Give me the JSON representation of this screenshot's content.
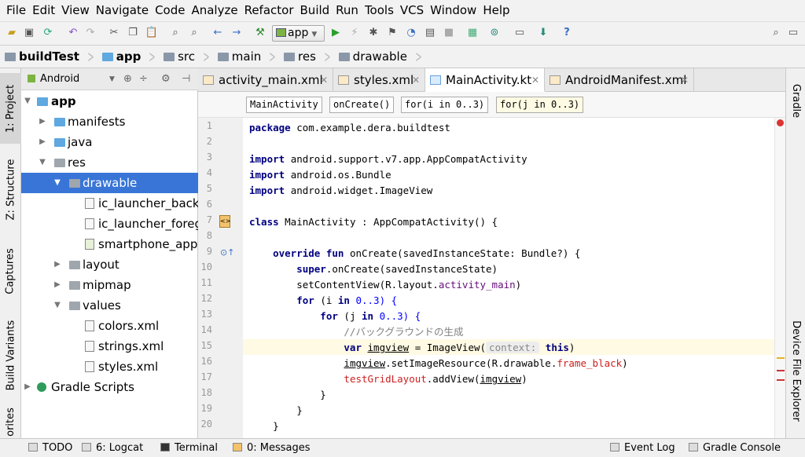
{
  "menu": [
    "File",
    "Edit",
    "View",
    "Navigate",
    "Code",
    "Analyze",
    "Refactor",
    "Build",
    "Run",
    "Tools",
    "VCS",
    "Window",
    "Help"
  ],
  "toolbar": {
    "run_config": "app"
  },
  "breadcrumb": [
    "buildTest",
    "app",
    "src",
    "main",
    "res",
    "drawable"
  ],
  "left_tabs": {
    "project": "1: Project",
    "structure": "Z: Structure",
    "captures": "Captures",
    "build_variants": "Build Variants",
    "favorites": "orites"
  },
  "project_panel": {
    "view_mode": "Android"
  },
  "tree": [
    {
      "label": "app"
    },
    {
      "label": "manifests"
    },
    {
      "label": "java"
    },
    {
      "label": "res"
    },
    {
      "label": "drawable"
    },
    {
      "label": "ic_launcher_backg"
    },
    {
      "label": "ic_launcher_foreg"
    },
    {
      "label": "smartphone_app.p"
    },
    {
      "label": "layout"
    },
    {
      "label": "mipmap"
    },
    {
      "label": "values"
    },
    {
      "label": "colors.xml"
    },
    {
      "label": "strings.xml"
    },
    {
      "label": "styles.xml"
    },
    {
      "label": "Gradle Scripts"
    }
  ],
  "tabs": [
    "activity_main.xml",
    "styles.xml",
    "MainActivity.kt",
    "AndroidManifest.xml"
  ],
  "code_breadcrumb": [
    "MainActivity",
    "onCreate()",
    "for(i in 0..3)",
    "for(j in 0..3)"
  ],
  "line_numbers": [
    "1",
    "2",
    "3",
    "4",
    "5",
    "6",
    "7",
    "8",
    "9",
    "10",
    "11",
    "12",
    "13",
    "14",
    "15",
    "16",
    "17",
    "18",
    "19",
    "20"
  ],
  "code": {
    "l1a": "package ",
    "l1b": "com.example.dera.buildtest",
    "l3a": "import ",
    "l3b": "android.support.v7.app.AppCompatActivity",
    "l4a": "import ",
    "l4b": "android.os.Bundle",
    "l5a": "import ",
    "l5b": "android.widget.ImageView",
    "l7a": "class ",
    "l7b": "MainActivity : AppCompatActivity() {",
    "l9a": "    override fun ",
    "l9b": "onCreate(savedInstanceState: Bundle?) {",
    "l10a": "        super",
    "l10b": ".onCreate(savedInstanceState)",
    "l11a": "        setContentView(R.layout.",
    "l11b": "activity_main",
    "l11c": ")",
    "l12a": "        for ",
    "l12b": "(i ",
    "l12c": "in ",
    "l12d": "0..3) {",
    "l13a": "            for ",
    "l13b": "(j ",
    "l13c": "in ",
    "l13d": "0..3) {",
    "l14": "                //バックグラウンドの生成",
    "l15a": "                var ",
    "l15b": "imgview",
    "l15c": " = ImageView(",
    "l15d": "context:",
    "l15e": " this",
    ")": ")",
    "l16a": "                ",
    "l16b": "imgview",
    "l16c": ".setImageResource(R.drawable.",
    "l16d": "frame_black",
    "l16e": ")",
    "l17a": "                ",
    "l17b": "testGridLayout",
    "l17c": ".addView(",
    "l17d": "imgview",
    "l17e": ")",
    "l18": "            }",
    "l19": "        }",
    "l20": "    }"
  },
  "right_tabs": {
    "gradle": "Gradle",
    "device_explorer": "Device File Explorer"
  },
  "status": {
    "todo": "TODO",
    "logcat": "6: Logcat",
    "terminal": "Terminal",
    "messages": "0: Messages",
    "event_log": "Event Log",
    "gradle_console": "Gradle Console"
  },
  "colors": {
    "selection": "#3875d7",
    "keyword": "#000080",
    "purple": "#660e7a",
    "error": "#cc1f1f",
    "current_line": "#fffae3"
  }
}
